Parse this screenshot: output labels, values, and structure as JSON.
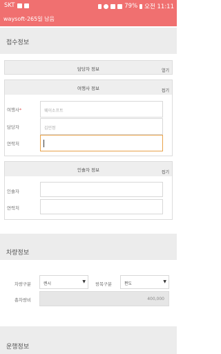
{
  "statusbar": {
    "carrier": "SKT",
    "battery": "79%",
    "time": "오전 11:11"
  },
  "appbar": {
    "title": "waysoft-265일 남음"
  },
  "sections": {
    "reception": "접수정보",
    "vehicle": "차량정보",
    "operation": "운행정보"
  },
  "manager_panel": {
    "title": "담당자 정보",
    "toggle": "열기"
  },
  "agency_panel": {
    "title": "여행사 정보",
    "toggle": "접기",
    "agency_label": "여행사",
    "required_mark": "*",
    "agency_placeholder": "웨이소프트",
    "manager_label": "담당자",
    "manager_placeholder": "김민정",
    "contact_label": "연락처",
    "contact_value": ""
  },
  "guide_panel": {
    "title": "인솔자 정보",
    "toggle": "접기",
    "guide_label": "인솔자",
    "contact_label": "연락처"
  },
  "vehicle": {
    "type_label": "차량구분",
    "type_value": "렌시",
    "trip_label": "왕복구분",
    "trip_value": "편도",
    "fare_label": "총차량비",
    "fare_value": "400,000"
  }
}
